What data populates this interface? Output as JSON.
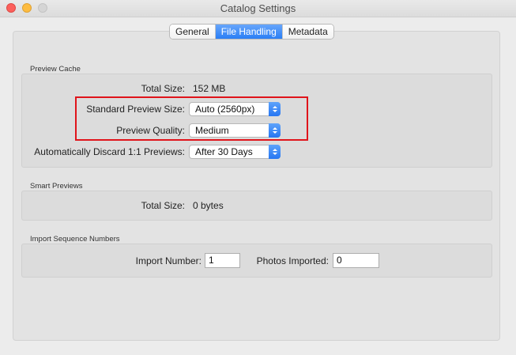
{
  "window": {
    "title": "Catalog Settings"
  },
  "tabs": [
    {
      "label": "General",
      "active": false
    },
    {
      "label": "File Handling",
      "active": true
    },
    {
      "label": "Metadata",
      "active": false
    }
  ],
  "preview_cache": {
    "section_label": "Preview Cache",
    "total_size_label": "Total Size:",
    "total_size_value": "152 MB",
    "standard_preview_label": "Standard Preview Size:",
    "standard_preview_value": "Auto (2560px)",
    "preview_quality_label": "Preview Quality:",
    "preview_quality_value": "Medium",
    "discard_label": "Automatically Discard 1:1 Previews:",
    "discard_value": "After 30 Days"
  },
  "smart_previews": {
    "section_label": "Smart Previews",
    "total_size_label": "Total Size:",
    "total_size_value": "0 bytes"
  },
  "import_sequence": {
    "section_label": "Import Sequence Numbers",
    "import_number_label": "Import Number:",
    "import_number_value": "1",
    "photos_imported_label": "Photos Imported:",
    "photos_imported_value": "0"
  },
  "colors": {
    "accent": "#2a7ef5",
    "highlight_box": "#e0141b"
  }
}
